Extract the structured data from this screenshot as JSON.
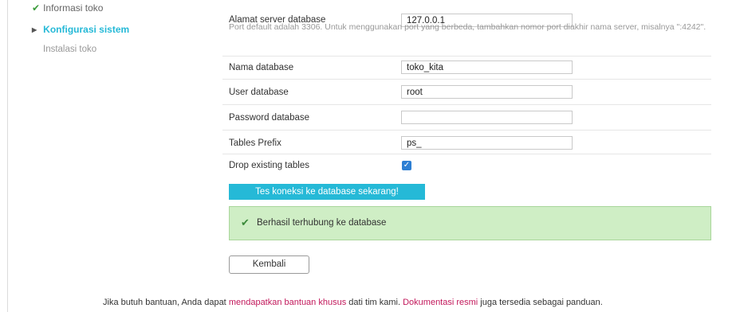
{
  "steps": {
    "done_label": "Informasi toko",
    "active_label": "Konfigurasi sistem",
    "todo_label": "Instalasi toko"
  },
  "form": {
    "server": {
      "label": "Alamat server database",
      "value": "127.0.0.1",
      "help": "Port default adalah 3306. Untuk menggunakan port yang berbeda, tambahkan nomor port diakhir nama server, misalnya \":4242\"."
    },
    "db_name": {
      "label": "Nama database",
      "value": "toko_kita"
    },
    "db_user": {
      "label": "User database",
      "value": "root"
    },
    "db_password": {
      "label": "Password database",
      "value": ""
    },
    "prefix": {
      "label": "Tables Prefix",
      "value": "ps_"
    },
    "drop": {
      "label": "Drop existing tables",
      "checked": true
    }
  },
  "test_button": "Tes koneksi ke database sekarang!",
  "success_message": "Berhasil terhubung ke database",
  "back_button": "Kembali",
  "footer": {
    "part1": "Jika butuh bantuan, Anda dapat ",
    "link1": "mendapatkan bantuan khusus",
    "part2": " dati tim kami. ",
    "link2": "Dokumentasi resmi",
    "part3": " juga tersedia sebagai panduan."
  },
  "colors": {
    "accent": "#25b9d7",
    "success_bg": "#cfeec5",
    "link": "#c2185b",
    "check": "#2d7fd3"
  }
}
